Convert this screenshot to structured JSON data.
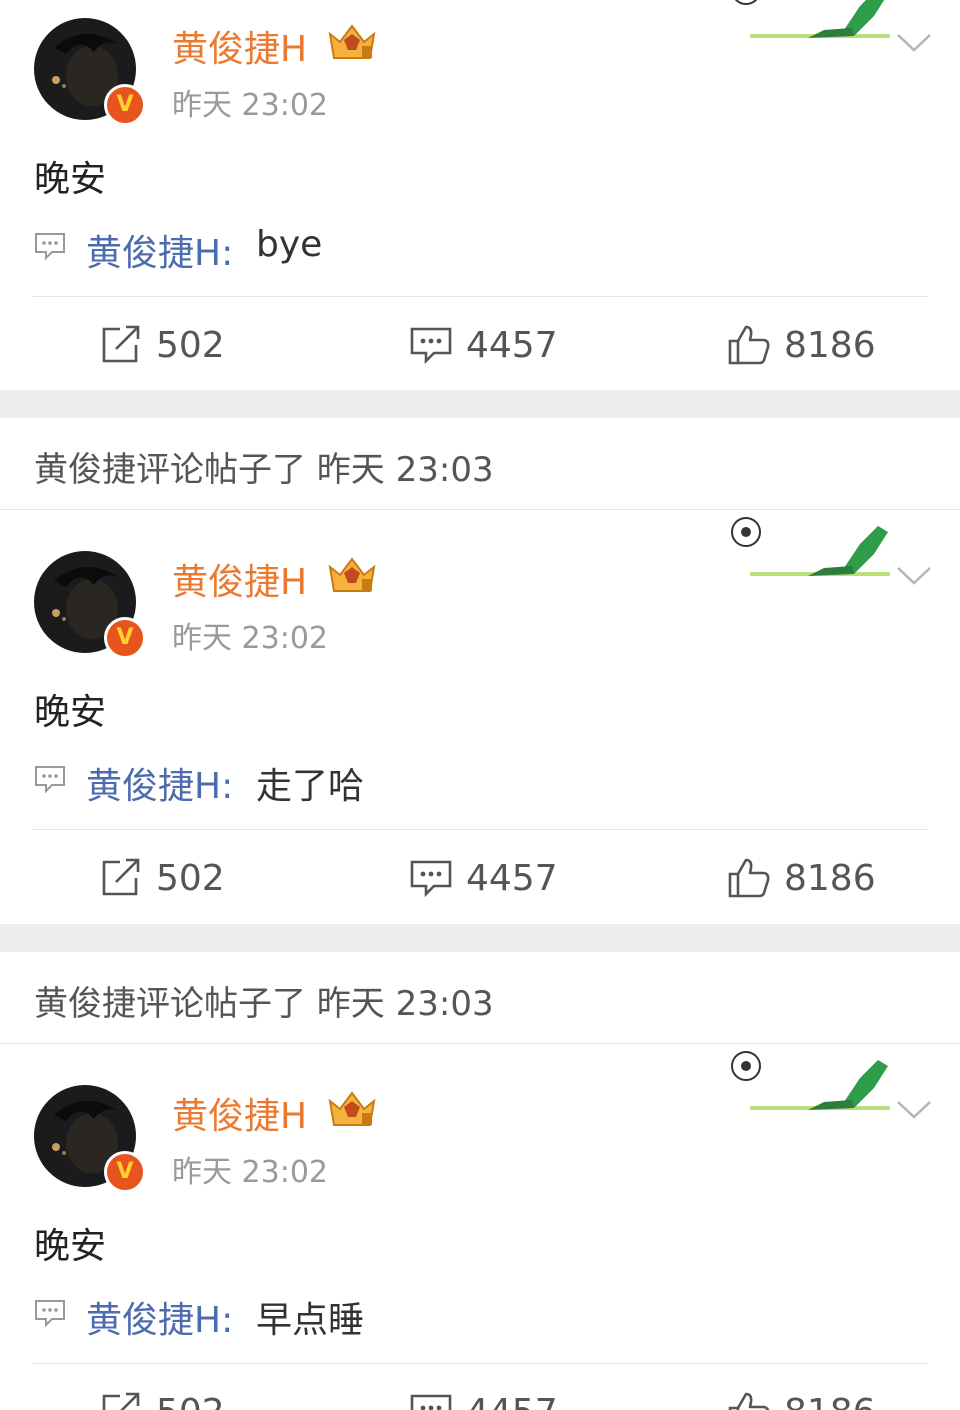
{
  "feed": [
    {
      "context": "",
      "author": "黄俊捷H",
      "time": "昨天 23:02",
      "text": "晚安",
      "comment_author": "黄俊捷H:",
      "comment_text": "bye",
      "shares": "502",
      "comments": "4457",
      "likes": "8186"
    },
    {
      "context": "黄俊捷评论帖子了 昨天 23:03",
      "author": "黄俊捷H",
      "time": "昨天 23:02",
      "text": "晚安",
      "comment_author": "黄俊捷H:",
      "comment_text": "走了哈",
      "shares": "502",
      "comments": "4457",
      "likes": "8186"
    },
    {
      "context": "黄俊捷评论帖子了 昨天 23:03",
      "author": "黄俊捷H",
      "time": "昨天 23:02",
      "text": "晚安",
      "comment_author": "黄俊捷H:",
      "comment_text": "早点睡",
      "shares": "502",
      "comments": "4457",
      "likes": "8186"
    }
  ],
  "icons": {
    "verified": "verified-v-icon",
    "membership": "crown-vip-icon",
    "card_decoration": "soccer-kick-icon",
    "more": "chevron-down-icon",
    "comment_preview": "comment-bubble-icon",
    "share": "share-icon",
    "comment": "comment-icon",
    "like": "thumbs-up-icon"
  },
  "badge_letter": "V",
  "colors": {
    "username": "#eb7a30",
    "comment_author": "#4d6cae",
    "timestamp": "#9a9a9a",
    "separator": "#eeeeee",
    "verified_badge": "#e8541d"
  }
}
